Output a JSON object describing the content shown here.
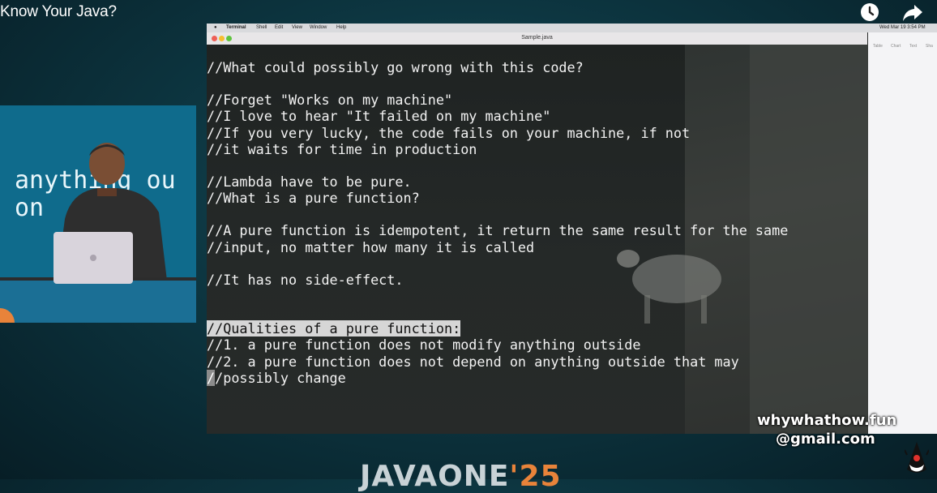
{
  "video": {
    "title": "Know Your Java?",
    "watch_later_icon": "clock-icon",
    "share_icon": "share-arrow-icon"
  },
  "speaker": {
    "screen_text_line1": "anything ou",
    "screen_text_line2": "on    ing"
  },
  "mac": {
    "menubar": {
      "app": "Terminal",
      "items": [
        "Shell",
        "Edit",
        "View",
        "Window",
        "Help"
      ],
      "clock": "Wed Mar 19  3:54 PM"
    },
    "window_title": "Sample.java",
    "right_app_toolbar": [
      "Table",
      "Chart",
      "Text",
      "Sha"
    ]
  },
  "code": {
    "lines": [
      "//What could possibly go wrong with this code?",
      "",
      "//Forget \"Works on my machine\"",
      "//I love to hear \"It failed on my machine\"",
      "//If you very lucky, the code fails on your machine, if not",
      "//it waits for time in production",
      "",
      "//Lambda have to be pure.",
      "//What is a pure function?",
      "",
      "//A pure function is idempotent, it return the same result for the same",
      "//input, no matter how many it is called",
      "",
      "//It has no side-effect.",
      "",
      "",
      "//Qualities of a pure function:",
      "//1. a pure function does not modify anything outside",
      "//2. a pure function does not depend on anything outside that may",
      "//possibly change"
    ],
    "highlighted_line": 16,
    "cursor_line": 19
  },
  "watermark": {
    "line1": "whywhathow.fun",
    "line2": "@gmail.com"
  },
  "event": {
    "brand": "JAVAONE",
    "year": "'25"
  },
  "colors": {
    "accent_orange": "#e8833a",
    "terminal_bg": "#232726",
    "terminal_text": "#f2f2f2"
  }
}
